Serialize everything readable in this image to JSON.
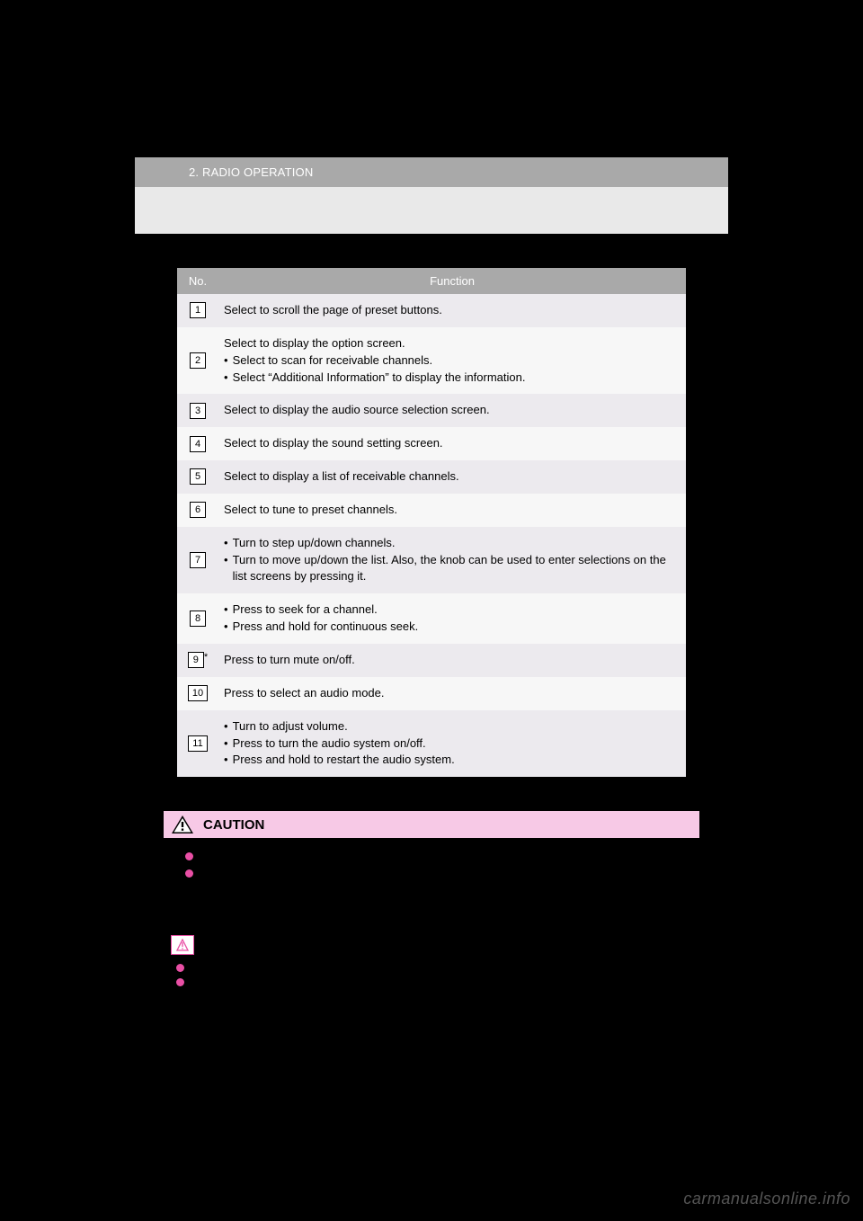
{
  "header": "2. RADIO OPERATION",
  "table": {
    "headers": {
      "no": "No.",
      "func": "Function"
    },
    "rows": [
      {
        "num": "1",
        "text": "Select to scroll the page of preset buttons."
      },
      {
        "num": "2",
        "text": "Select to display the option screen.",
        "bullets": [
          "Select to scan for receivable channels.",
          "Select “Additional Information” to display the information."
        ]
      },
      {
        "num": "3",
        "text": "Select to display the audio source selection screen."
      },
      {
        "num": "4",
        "text": "Select to display the sound setting screen."
      },
      {
        "num": "5",
        "text": "Select to display a list of receivable channels."
      },
      {
        "num": "6",
        "text": "Select to tune to preset channels."
      },
      {
        "num": "7",
        "bullets": [
          "Turn to step up/down channels.",
          "Turn to move up/down the list. Also, the knob can be used to enter selections on the list screens by pressing it."
        ]
      },
      {
        "num": "8",
        "bullets": [
          "Press to seek for a channel.",
          "Press and hold for continuous seek."
        ]
      },
      {
        "num": "9",
        "suffix": "*",
        "text": "Press to turn mute on/off."
      },
      {
        "num": "10",
        "wide": true,
        "text": "Press to select an audio mode."
      },
      {
        "num": "11",
        "wide": true,
        "bullets": [
          "Turn to adjust volume.",
          "Press to turn the audio system on/off.",
          "Press and hold to restart the audio system."
        ]
      }
    ]
  },
  "caution": {
    "title": "CAUTION",
    "lines": [
      "",
      ""
    ]
  },
  "notice": {
    "lines": [
      "",
      ""
    ]
  },
  "watermark": "carmanualsonline.info"
}
